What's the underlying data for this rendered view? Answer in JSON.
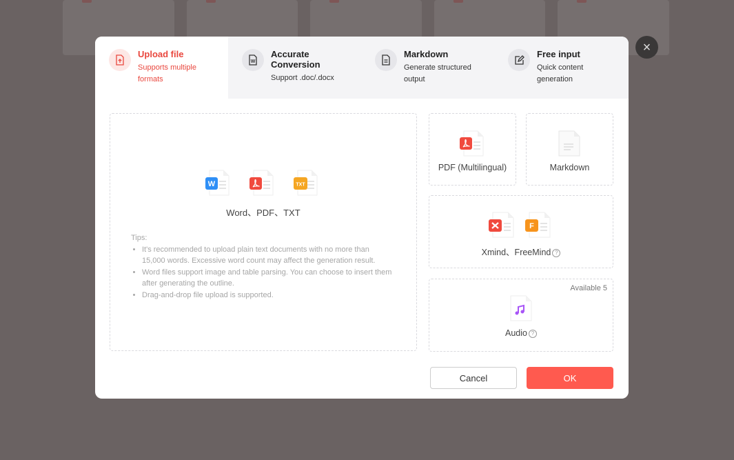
{
  "tabs": [
    {
      "title": "Upload file",
      "subtitle": "Supports multiple formats",
      "icon": "upload-file-icon",
      "active": true
    },
    {
      "title": "Accurate Conversion",
      "subtitle": "Support .doc/.docx",
      "icon": "word-doc-icon",
      "active": false
    },
    {
      "title": "Markdown",
      "subtitle": "Generate structured output",
      "icon": "document-lines-icon",
      "active": false
    },
    {
      "title": "Free input",
      "subtitle": "Quick content generation",
      "icon": "edit-pencil-icon",
      "active": false
    }
  ],
  "upload": {
    "formats_caption": "Word、PDF、TXT",
    "tips_title": "Tips:",
    "tips": [
      "It's recommended to upload plain text documents with no more than 15,000 words. Excessive word count may affect the generation result.",
      "Word files support image and table parsing. You can choose to insert them after generating the outline.",
      "Drag-and-drop file upload is supported."
    ]
  },
  "options": {
    "pdf": "PDF (Multilingual)",
    "markdown": "Markdown",
    "mindmap": "Xmind、FreeMind",
    "audio": "Audio",
    "audio_available": "Available 5",
    "help_glyph": "?"
  },
  "buttons": {
    "cancel": "Cancel",
    "ok": "OK",
    "close": "×"
  },
  "colors": {
    "accent": "#ff5a4f",
    "active_text": "#e9473e",
    "word": "#2f8ff6",
    "pdf": "#f04a3e",
    "txt": "#f5a623",
    "audio": "#a855f7"
  }
}
